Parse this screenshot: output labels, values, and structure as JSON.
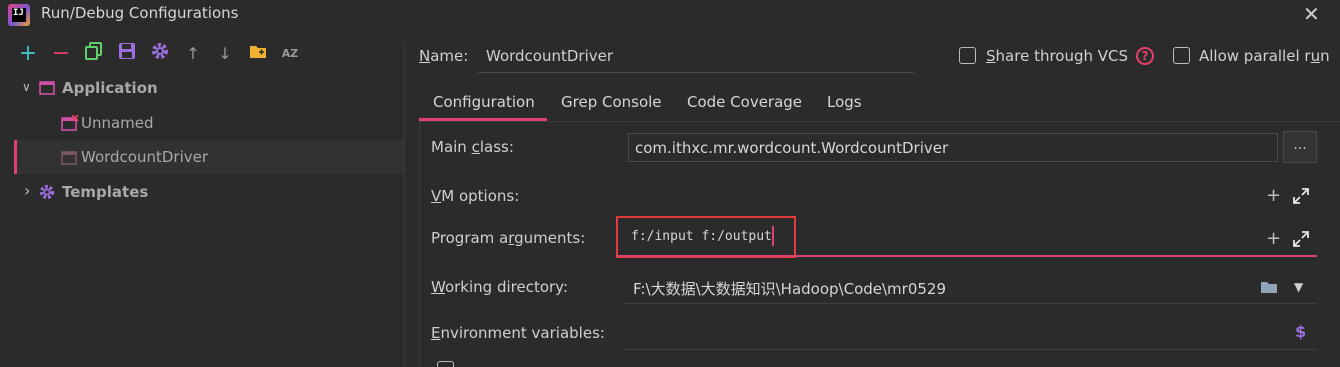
{
  "window": {
    "title": "Run/Debug Configurations",
    "close_label": "✕",
    "app_icon_label": "IJ"
  },
  "toolbar": {
    "icons": [
      "add-icon",
      "remove-icon",
      "copy-icon",
      "save-icon",
      "settings-icon",
      "move-up-icon",
      "move-down-icon",
      "folder-icon",
      "sort-az-icon"
    ],
    "add_glyph": "+",
    "remove_glyph": "−",
    "up_glyph": "↑",
    "down_glyph": "↓",
    "sort_glyph": "AZ"
  },
  "tree": {
    "application": {
      "label": "Application",
      "chevron": "∨"
    },
    "items": [
      {
        "label": "Unnamed"
      },
      {
        "label": "WordcountDriver"
      }
    ],
    "templates": {
      "label": "Templates",
      "chevron": "›"
    }
  },
  "header": {
    "name_label_u": "N",
    "name_label_rest": "ame:",
    "name_value": "WordcountDriver",
    "share_label_u": "S",
    "share_label_rest": "hare through VCS",
    "help_glyph": "?",
    "parallel_label_pre": "Allow parallel r",
    "parallel_label_u": "u",
    "parallel_label_post": "n"
  },
  "tabs": [
    {
      "label": "Configuration"
    },
    {
      "label": "Grep Console"
    },
    {
      "label": "Code Coverage"
    },
    {
      "label": "Logs"
    }
  ],
  "form": {
    "main_class_label_pre": "Main ",
    "main_class_label_u": "c",
    "main_class_label_post": "lass:",
    "main_class_value": "com.ithxc.mr.wordcount.WordcountDriver",
    "browse_label": "...",
    "vm_label_u": "V",
    "vm_label_rest": "M options:",
    "program_label_pre": "Program a",
    "program_label_u": "r",
    "program_label_post": "guments:",
    "program_value": "f:/input f:/output",
    "working_label_u": "W",
    "working_label_rest": "orking directory:",
    "working_value": "F:\\大数据\\大数据知识\\Hadoop\\Code\\mr0529",
    "env_label_u": "E",
    "env_label_rest": "nvironment variables:",
    "plus_glyph": "+",
    "dollar_glyph": "$",
    "dropdown_glyph": "▼"
  },
  "colors": {
    "accent": "#e0406f",
    "highlight_box": "#e33b3b",
    "dialog_bg": "#2b2b2b"
  }
}
